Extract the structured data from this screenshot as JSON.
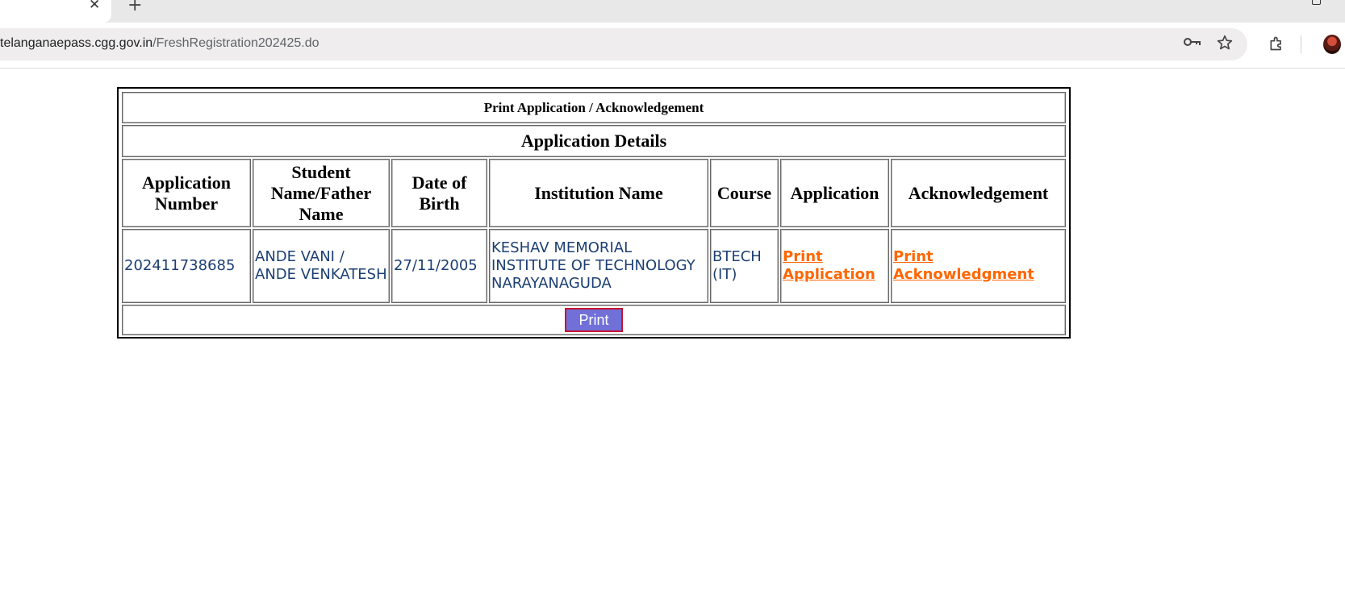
{
  "browser": {
    "tab_close": "✕",
    "new_tab": "+",
    "url_host": "telanganaepass.cgg.gov.in",
    "url_path": "/FreshRegistration202425.do",
    "icons": [
      "key-icon",
      "star-icon",
      "extensions-icon",
      "avatar"
    ]
  },
  "page": {
    "title": "Print Application / Acknowledgement",
    "section": "Application Details",
    "columns": [
      "Application Number",
      "Student Name/Father Name",
      "Date of Birth",
      "Institution Name",
      "Course",
      "Application",
      "Acknowledgement"
    ],
    "row": {
      "application_number": "202411738685",
      "student_father_name": "ANDE VANI / ANDE VENKATESH",
      "date_of_birth": "27/11/2005",
      "institution_name": "KESHAV MEMORIAL INSTITUTE OF TECHNOLOGY NARAYANAGUDA",
      "course": "BTECH (IT)",
      "application_link": "Print Application",
      "acknowledgement_link": "Print Acknowledgment"
    },
    "print_button": "Print"
  },
  "colors": {
    "link": "#ff6600",
    "data_text": "#1c3f73",
    "button_bg": "#7070d8",
    "button_border": "#c8102e"
  }
}
